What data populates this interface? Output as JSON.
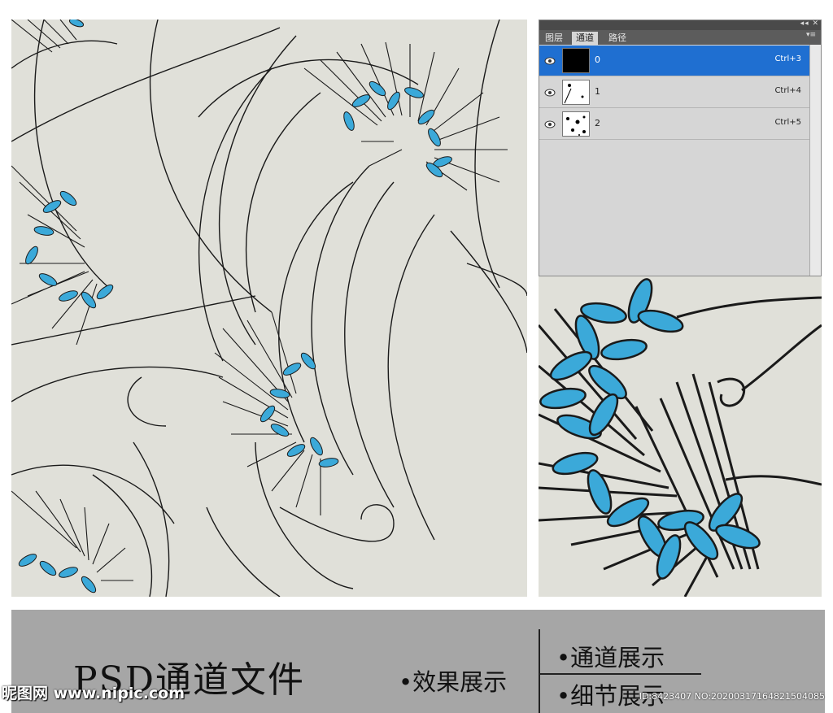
{
  "panel": {
    "tabs": [
      "图层",
      "通道",
      "路径"
    ],
    "active_tab": "通道",
    "controls": "◂◂ ✕",
    "menu": "▾≡",
    "channels": [
      {
        "name": "0",
        "shortcut": "Ctrl+3",
        "selected": true
      },
      {
        "name": "1",
        "shortcut": "Ctrl+4",
        "selected": false
      },
      {
        "name": "2",
        "shortcut": "Ctrl+5",
        "selected": false
      }
    ],
    "eye_icon": "eye-icon"
  },
  "banner": {
    "title": "PSD通道文件",
    "effect_label": "•效果展示",
    "channel_label": "•通道展示",
    "detail_label": "•细节展示"
  },
  "watermark": {
    "logo": "昵图网 www.nipic.com",
    "id": "ID:8423407 NO:20200317164821504085"
  },
  "colors": {
    "background": "#e0e0d9",
    "petal": "#3ba9d9",
    "line": "#1a1a1a",
    "selection": "#1f6fd1",
    "banner": "#a6a6a6"
  }
}
